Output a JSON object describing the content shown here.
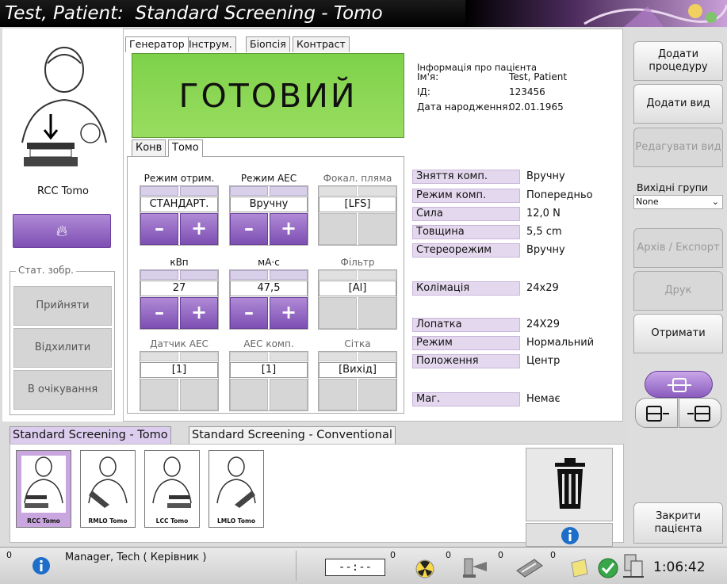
{
  "title": "Test, Patient:  Standard Screening - Tomo",
  "generator_tabs": [
    "Генератор",
    "Інструм.",
    "Біопсія",
    "Контраст"
  ],
  "status_ready": "ГОТОВИЙ",
  "patient_info": {
    "header": "Інформація про пацієнта",
    "rows": [
      {
        "label": "Ім'я:",
        "value": "Test, Patient"
      },
      {
        "label": "ІД:",
        "value": "123456"
      },
      {
        "label": "Дата народження:",
        "value": "02.01.1965"
      }
    ]
  },
  "sub_tabs": [
    "Конв",
    "Томо"
  ],
  "controls": {
    "mode": {
      "label": "Режим отрим.",
      "value": "СТАНДАРТ."
    },
    "aec_mode": {
      "label": "Режим AEC",
      "value": "Вручну"
    },
    "focal": {
      "label": "Фокал. пляма",
      "value": "[LFS]"
    },
    "kv": {
      "label": "кВп",
      "value": "27"
    },
    "mas": {
      "label": "мА·с",
      "value": "47,5"
    },
    "filter": {
      "label": "Фільтр",
      "value": "[Al]"
    },
    "aec_sensor": {
      "label": "Датчик AEC",
      "value": "[1]"
    },
    "aec_comp": {
      "label": "AEC комп.",
      "value": "[1]"
    },
    "grid": {
      "label": "Сітка",
      "value": "[Вихід]"
    },
    "minus": "–",
    "plus": "+"
  },
  "params": [
    {
      "label": "Зняття комп.",
      "value": "Вручну"
    },
    {
      "label": "Режим комп.",
      "value": "Попередньо"
    },
    {
      "label": "Сила",
      "value": "12,0 N"
    },
    {
      "label": "Товщина",
      "value": "5,5 cm"
    },
    {
      "label": "Стереорежим",
      "value": "Вручну"
    },
    {
      "label": "Колімація",
      "value": "24x29"
    },
    {
      "label": "Лопатка",
      "value": "24X29"
    },
    {
      "label": "Режим",
      "value": "Нормальний"
    },
    {
      "label": "Положення",
      "value": "Центр"
    },
    {
      "label": "Маг.",
      "value": "Немає"
    }
  ],
  "view_name": "RCC Tomo",
  "image_status": {
    "title": "Стат. зобр.",
    "accept": "Прийняти",
    "reject": "Відхилити",
    "pending": "В очікування"
  },
  "sequence_tabs": [
    "Standard Screening - Tomo",
    "Standard Screening - Conventional"
  ],
  "thumbnails": [
    "RCC Tomo",
    "RMLO Tomo",
    "LCC Tomo",
    "LMLO Tomo"
  ],
  "right_panel": {
    "add_procedure": "Додати процедуру",
    "add_view": "Додати вид",
    "edit_view": "Редагувати вид",
    "output_groups_label": "Вихідні групи",
    "output_groups_value": "None",
    "archive_export": "Архів / Експорт",
    "print": "Друк",
    "retrieve": "Отримати",
    "close_patient": "Закрити пацієнта"
  },
  "statusbar": {
    "alert_count": "0",
    "user": "Manager, Tech ( Керівник )",
    "timer": "--:--",
    "counts": [
      "0",
      "0",
      "0",
      "0",
      "0"
    ],
    "clock": "1:06:42"
  },
  "colors": {
    "ready_green": "#8fd857",
    "purple": "#8a5cbf",
    "param_bg": "#e4d8ee"
  }
}
